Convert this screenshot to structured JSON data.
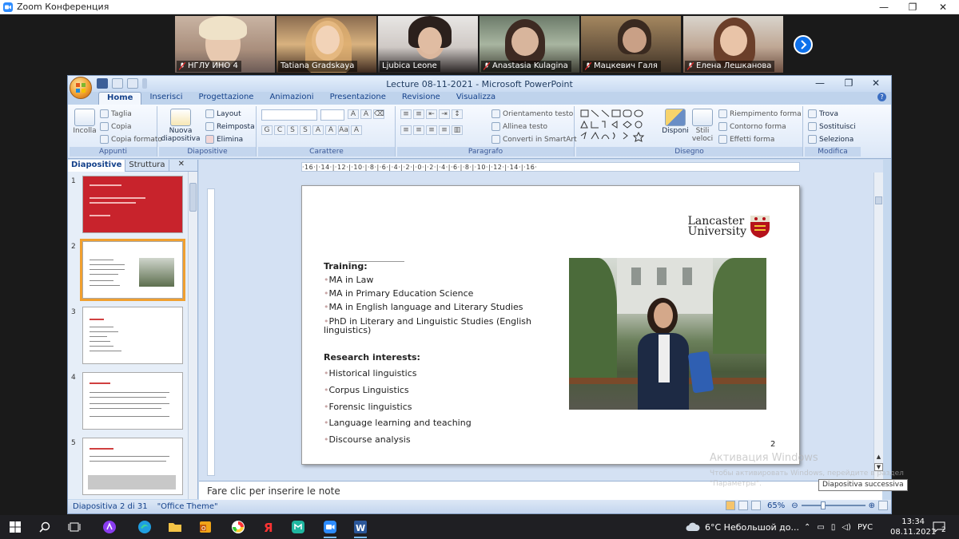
{
  "zoom": {
    "window_title": "Zoom Конференция",
    "participants": [
      {
        "name": "НГЛУ ИНО 4",
        "muted": true
      },
      {
        "name": "Tatiana Gradskaya",
        "muted": false
      },
      {
        "name": "Ljubica Leone",
        "muted": false
      },
      {
        "name": "Anastasia Kulagina",
        "muted": true
      },
      {
        "name": "Мацкевич Галя",
        "muted": true
      },
      {
        "name": "Елена Лешканова",
        "muted": true
      }
    ]
  },
  "powerpoint": {
    "window_title": "Lecture 08-11-2021 - Microsoft PowerPoint",
    "tabs": [
      "Home",
      "Inserisci",
      "Progettazione",
      "Animazioni",
      "Presentazione",
      "Revisione",
      "Visualizza"
    ],
    "active_tab": "Home",
    "groups": {
      "appunti": {
        "label": "Appunti",
        "incolla": "Incolla",
        "taglia": "Taglia",
        "copia": "Copia",
        "copia_formato": "Copia formato"
      },
      "diapositive": {
        "label": "Diapositive",
        "nuova": "Nuova",
        "diapositiva": "diapositiva",
        "layout": "Layout",
        "reimposta": "Reimposta",
        "elimina": "Elimina"
      },
      "carattere": {
        "label": "Carattere"
      },
      "paragrafo": {
        "label": "Paragrafo",
        "orientamento": "Orientamento testo",
        "allinea": "Allinea testo",
        "converti": "Converti in SmartArt"
      },
      "disegno": {
        "label": "Disegno",
        "disponi": "Disponi",
        "stili": "Stili",
        "veloci": "veloci",
        "riempimento": "Riempimento forma",
        "contorno": "Contorno forma",
        "effetti": "Effetti forma"
      },
      "modifica": {
        "label": "Modifica",
        "trova": "Trova",
        "sostituisci": "Sostituisci",
        "seleziona": "Seleziona"
      }
    },
    "panel_tabs": {
      "diapositive": "Diapositive",
      "struttura": "Struttura"
    },
    "ruler_text": "·16·|·14·|·12·|·10·|·8·|·6·|·4·|·2·|·0·|·2·|·4·|·6·|·8·|·10·|·12·|·14·|·16·",
    "thumbnails": [
      {
        "num": "1"
      },
      {
        "num": "2"
      },
      {
        "num": "3"
      },
      {
        "num": "4"
      },
      {
        "num": "5"
      }
    ],
    "slide": {
      "logo_line1": "Lancaster",
      "logo_line2": "University",
      "training_heading": "Training:",
      "training_items": [
        "MA in Law",
        "MA in Primary Education Science",
        "MA in English language and Literary Studies",
        "PhD in Literary and Linguistic Studies (English",
        "linguistics)"
      ],
      "research_heading": "Research interests:",
      "research_items": [
        "Historical linguistics",
        "Corpus Linguistics",
        "Forensic linguistics",
        "Language learning and teaching",
        "Discourse analysis"
      ],
      "page_number": "2",
      "bullet": "•"
    },
    "notes_placeholder": "Fare clic per inserire le note",
    "status": {
      "slide_info": "Diapositiva 2 di 31",
      "theme": "\"Office Theme\"",
      "zoom": "65%"
    },
    "tooltip": "Diapositiva successiva"
  },
  "activation": {
    "line1": "Активация Windows",
    "line2": "Чтобы активировать Windows, перейдите в раздел",
    "line3": "\"Параметры\"."
  },
  "taskbar": {
    "weather": "6°C  Небольшой до...",
    "lang": "РУС",
    "time": "13:34",
    "date": "08.11.2021",
    "notifications": "2"
  }
}
